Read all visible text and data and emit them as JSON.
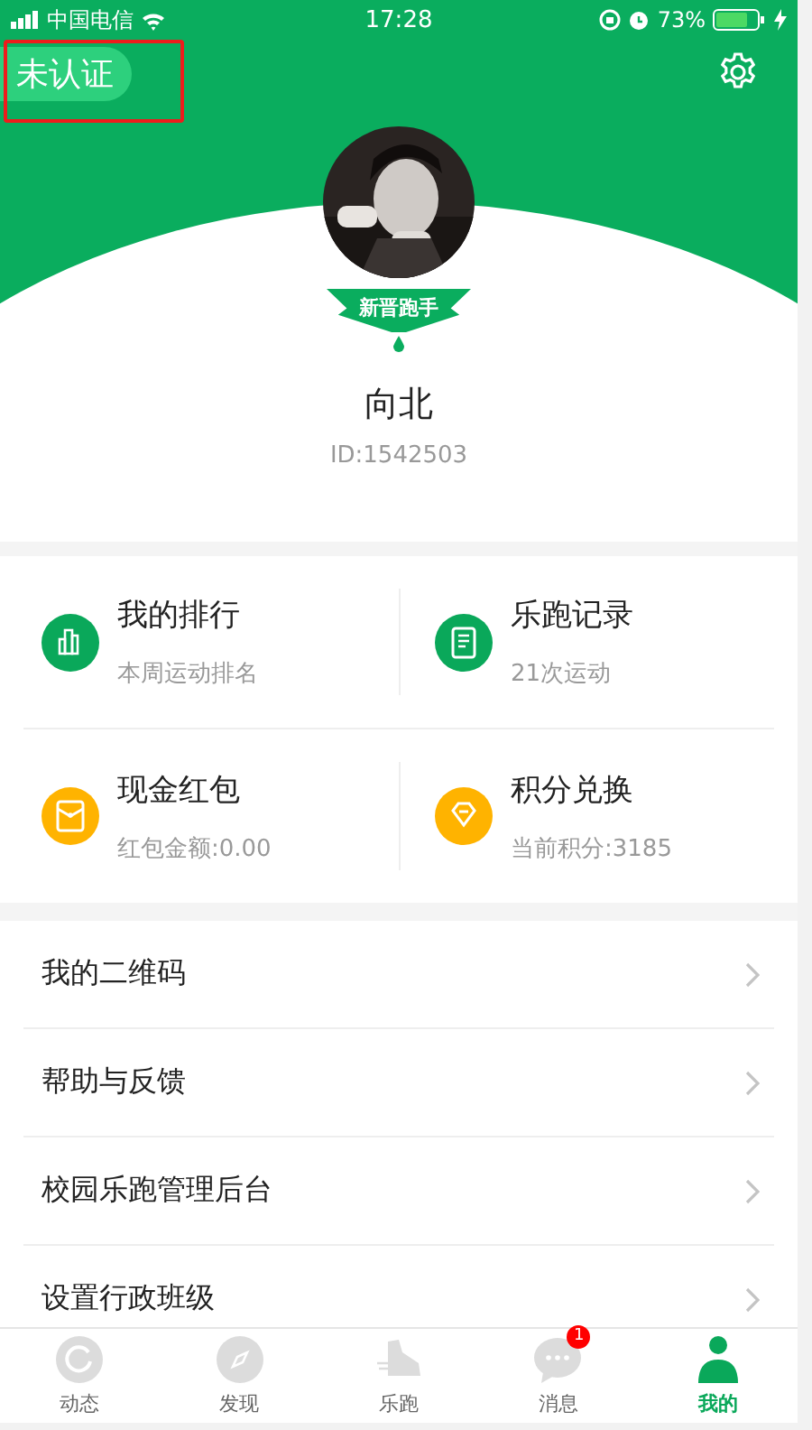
{
  "status_bar": {
    "carrier": "中国电信",
    "time": "17:28",
    "battery": "73%"
  },
  "header": {
    "verify_label": "未认证",
    "badge": "新晋跑手",
    "name": "向北",
    "user_id": "ID:1542503"
  },
  "stats": [
    {
      "title": "我的排行",
      "subtitle": "本周运动排名",
      "kind": "chart",
      "color": "#0aa85a"
    },
    {
      "title": "乐跑记录",
      "subtitle": "21次运动",
      "kind": "doc",
      "color": "#0aa85a"
    },
    {
      "title": "现金红包",
      "subtitle": "红包金额:0.00",
      "kind": "envelope",
      "color": "#ffb300"
    },
    {
      "title": "积分兑换",
      "subtitle": "当前积分:3185",
      "kind": "diamond",
      "color": "#ffb300"
    }
  ],
  "menu": [
    {
      "label": "我的二维码"
    },
    {
      "label": "帮助与反馈"
    },
    {
      "label": "校园乐跑管理后台"
    },
    {
      "label": "设置行政班级"
    }
  ],
  "tabs": [
    {
      "label": "动态",
      "kind": "refresh",
      "selected": false
    },
    {
      "label": "发现",
      "kind": "compass",
      "selected": false
    },
    {
      "label": "乐跑",
      "kind": "shoe",
      "selected": false
    },
    {
      "label": "消息",
      "kind": "chat",
      "selected": false,
      "badge": "1"
    },
    {
      "label": "我的",
      "kind": "person",
      "selected": true
    }
  ]
}
